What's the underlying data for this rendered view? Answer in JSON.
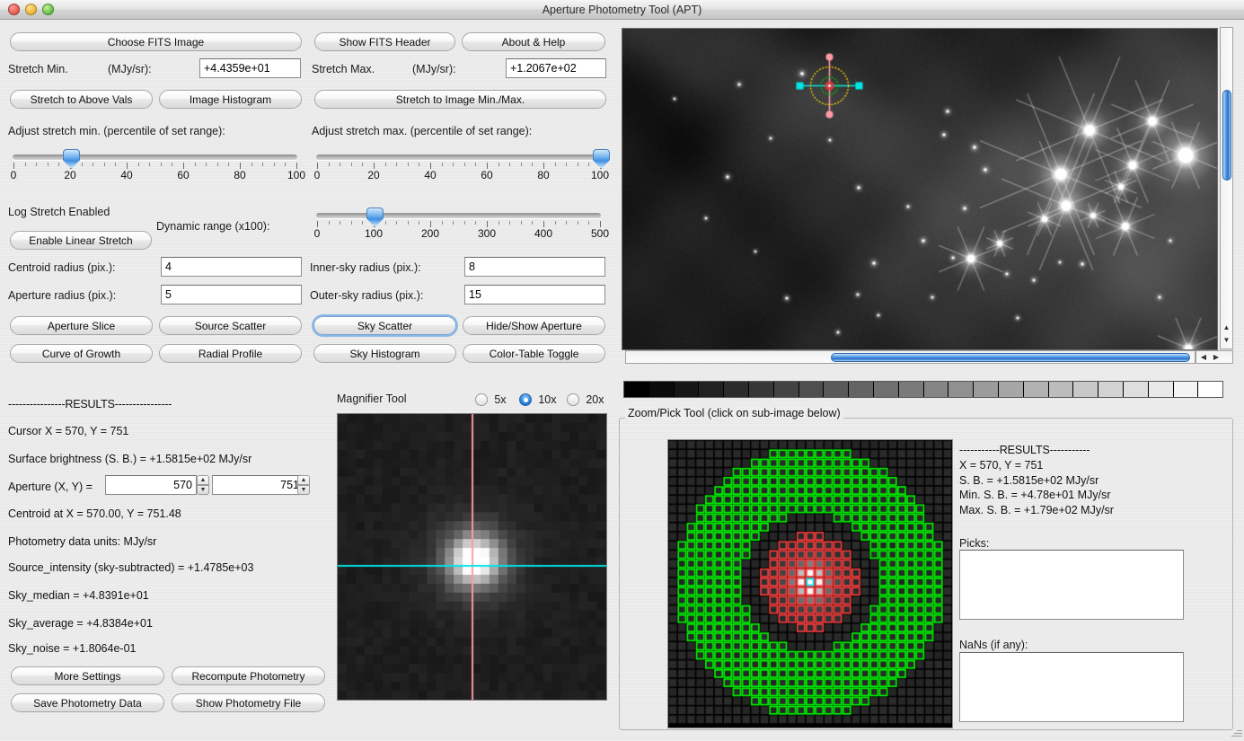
{
  "window": {
    "title": "Aperture Photometry Tool (APT)",
    "traffic_lights": [
      "close-button",
      "minimize-button",
      "zoom-button"
    ]
  },
  "toolbar": {
    "choose_fits_image": "Choose FITS Image",
    "show_fits_header": "Show FITS Header",
    "about_help": "About & Help"
  },
  "stretch": {
    "min_label": "Stretch Min.",
    "min_units": "(MJy/sr):",
    "min_value": "+4.4359e+01",
    "max_label": "Stretch Max.",
    "max_units": "(MJy/sr):",
    "max_value": "+1.2067e+02",
    "stretch_to_above_vals": "Stretch to Above Vals",
    "image_histogram": "Image Histogram",
    "stretch_to_image_minmax": "Stretch to Image Min./Max.",
    "adjust_min_label": "Adjust stretch min. (percentile of set range):",
    "adjust_max_label": "Adjust stretch max. (percentile of set range):",
    "min_slider": {
      "value": 20,
      "min": 0,
      "max": 100,
      "ticks": [
        "0",
        "20",
        "40",
        "60",
        "80",
        "100"
      ]
    },
    "max_slider": {
      "value": 100,
      "min": 0,
      "max": 100,
      "ticks": [
        "0",
        "20",
        "40",
        "60",
        "80",
        "100"
      ]
    },
    "log_stretch_status": "Log Stretch Enabled",
    "enable_linear_stretch": "Enable Linear Stretch",
    "dynamic_range_label": "Dynamic range (x100):",
    "dynamic_slider": {
      "value": 100,
      "min": 0,
      "max": 500,
      "ticks": [
        "0",
        "100",
        "200",
        "300",
        "400",
        "500"
      ]
    }
  },
  "radii": {
    "centroid_label": "Centroid radius (pix.):",
    "centroid_value": "4",
    "inner_sky_label": "Inner-sky radius (pix.):",
    "inner_sky_value": "8",
    "aperture_label": "Aperture radius (pix.):",
    "aperture_value": "5",
    "outer_sky_label": "Outer-sky radius (pix.):",
    "outer_sky_value": "15"
  },
  "plot_buttons": {
    "aperture_slice": "Aperture Slice",
    "source_scatter": "Source Scatter",
    "sky_scatter": "Sky Scatter",
    "hide_show_aperture": "Hide/Show Aperture",
    "curve_of_growth": "Curve of Growth",
    "radial_profile": "Radial Profile",
    "sky_histogram": "Sky Histogram",
    "color_table_toggle": "Color-Table Toggle"
  },
  "results": {
    "header": "----------------RESULTS----------------",
    "cursor": "Cursor X = 570, Y = 751",
    "surface_brightness": "Surface brightness (S. B.) = +1.5815e+02 MJy/sr",
    "aperture_label": "Aperture (X, Y) =",
    "aperture_x": "570",
    "aperture_y": "751",
    "centroid": "Centroid at X = 570.00, Y = 751.48",
    "units": "Photometry data units: MJy/sr",
    "source_intensity": "Source_intensity (sky-subtracted)  = +1.4785e+03",
    "sky_median": "Sky_median = +4.8391e+01",
    "sky_average": "Sky_average = +4.8384e+01",
    "sky_noise": "Sky_noise = +1.8064e-01",
    "more_settings": "More Settings",
    "recompute_photometry": "Recompute Photometry",
    "save_photometry_data": "Save Photometry Data",
    "show_photometry_file": "Show Photometry File"
  },
  "magnifier": {
    "title": "Magnifier Tool",
    "options": [
      "5x",
      "10x",
      "20x"
    ],
    "selected": "10x"
  },
  "zoompick": {
    "title": "Zoom/Pick Tool (click on sub-image below)",
    "results_header": "-----------RESULTS-----------",
    "xy": "X = 570, Y = 751",
    "sb": "S. B. = +1.5815e+02 MJy/sr",
    "min_sb": "Min. S. B. = +4.78e+01 MJy/sr",
    "max_sb": "Max. S. B. = +1.79e+02 MJy/sr",
    "picks_label": "Picks:",
    "picks_value": "",
    "nans_label": "NaNs (if any):",
    "nans_value": ""
  },
  "colorbar": {
    "steps": 24,
    "from": "#000000",
    "to": "#ffffff"
  },
  "colors": {
    "aperture_circle": "#ffd400",
    "centroid_circle": "#00c000",
    "source_marker": "#ff4040",
    "sky_annulus": "#00ff00",
    "crosshair_h": "#00e5e5",
    "crosshair_v": "#ff9aa8",
    "accent_blue": "#3e8ee4"
  }
}
